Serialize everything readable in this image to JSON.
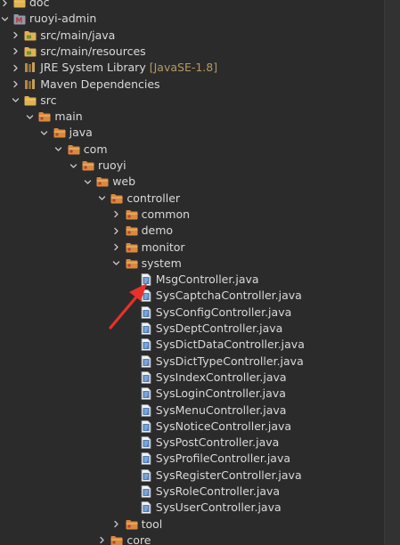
{
  "tree": {
    "items": [
      {
        "label": "doc",
        "decoration": "",
        "icon": "folder-icon",
        "depth": 0,
        "expanded": false
      },
      {
        "label": "ruoyi-admin",
        "decoration": "",
        "icon": "maven-project-icon",
        "depth": 0,
        "expanded": true
      },
      {
        "label": "src/main/java",
        "decoration": "",
        "icon": "source-folder-icon",
        "depth": 1,
        "expanded": false
      },
      {
        "label": "src/main/resources",
        "decoration": "",
        "icon": "source-folder-icon",
        "depth": 1,
        "expanded": false
      },
      {
        "label": "JRE System Library",
        "decoration": "[JavaSE-1.8]",
        "icon": "library-icon",
        "depth": 1,
        "expanded": false
      },
      {
        "label": "Maven Dependencies",
        "decoration": "",
        "icon": "library-icon",
        "depth": 1,
        "expanded": false
      },
      {
        "label": "src",
        "decoration": "",
        "icon": "folder-icon",
        "depth": 1,
        "expanded": true
      },
      {
        "label": "main",
        "decoration": "",
        "icon": "folder-icon",
        "depth": 2,
        "expanded": true
      },
      {
        "label": "java",
        "decoration": "",
        "icon": "folder-icon",
        "depth": 3,
        "expanded": true
      },
      {
        "label": "com",
        "decoration": "",
        "icon": "folder-icon",
        "depth": 4,
        "expanded": true
      },
      {
        "label": "ruoyi",
        "decoration": "",
        "icon": "folder-icon",
        "depth": 5,
        "expanded": true
      },
      {
        "label": "web",
        "decoration": "",
        "icon": "folder-icon",
        "depth": 6,
        "expanded": true
      },
      {
        "label": "controller",
        "decoration": "",
        "icon": "folder-icon",
        "depth": 7,
        "expanded": true
      },
      {
        "label": "common",
        "decoration": "",
        "icon": "folder-icon",
        "depth": 8,
        "expanded": false
      },
      {
        "label": "demo",
        "decoration": "",
        "icon": "folder-icon",
        "depth": 8,
        "expanded": false
      },
      {
        "label": "monitor",
        "decoration": "",
        "icon": "folder-icon",
        "depth": 8,
        "expanded": false
      },
      {
        "label": "system",
        "decoration": "",
        "icon": "folder-icon",
        "depth": 8,
        "expanded": true
      },
      {
        "label": "MsgController.java",
        "decoration": "",
        "icon": "java-file-icon",
        "depth": 9,
        "expanded": null
      },
      {
        "label": "SysCaptchaController.java",
        "decoration": "",
        "icon": "java-file-icon",
        "depth": 9,
        "expanded": null
      },
      {
        "label": "SysConfigController.java",
        "decoration": "",
        "icon": "java-file-icon",
        "depth": 9,
        "expanded": null
      },
      {
        "label": "SysDeptController.java",
        "decoration": "",
        "icon": "java-file-icon",
        "depth": 9,
        "expanded": null
      },
      {
        "label": "SysDictDataController.java",
        "decoration": "",
        "icon": "java-file-icon",
        "depth": 9,
        "expanded": null
      },
      {
        "label": "SysDictTypeController.java",
        "decoration": "",
        "icon": "java-file-icon",
        "depth": 9,
        "expanded": null
      },
      {
        "label": "SysIndexController.java",
        "decoration": "",
        "icon": "java-file-icon",
        "depth": 9,
        "expanded": null
      },
      {
        "label": "SysLoginController.java",
        "decoration": "",
        "icon": "java-file-icon",
        "depth": 9,
        "expanded": null
      },
      {
        "label": "SysMenuController.java",
        "decoration": "",
        "icon": "java-file-icon",
        "depth": 9,
        "expanded": null
      },
      {
        "label": "SysNoticeController.java",
        "decoration": "",
        "icon": "java-file-icon",
        "depth": 9,
        "expanded": null
      },
      {
        "label": "SysPostController.java",
        "decoration": "",
        "icon": "java-file-icon",
        "depth": 9,
        "expanded": null
      },
      {
        "label": "SysProfileController.java",
        "decoration": "",
        "icon": "java-file-icon",
        "depth": 9,
        "expanded": null
      },
      {
        "label": "SysRegisterController.java",
        "decoration": "",
        "icon": "java-file-icon",
        "depth": 9,
        "expanded": null
      },
      {
        "label": "SysRoleController.java",
        "decoration": "",
        "icon": "java-file-icon",
        "depth": 9,
        "expanded": null
      },
      {
        "label": "SysUserController.java",
        "decoration": "",
        "icon": "java-file-icon",
        "depth": 9,
        "expanded": null
      },
      {
        "label": "tool",
        "decoration": "",
        "icon": "folder-icon",
        "depth": 8,
        "expanded": false
      },
      {
        "label": "core",
        "decoration": "",
        "icon": "folder-icon",
        "depth": 7,
        "expanded": false
      }
    ],
    "highlighted_item": "MsgController.java"
  },
  "colors": {
    "background": "#2b2b2b",
    "text": "#d9d9d9",
    "decoration": "#b59a5d",
    "annotation_arrow": "#e8312a",
    "folder": "#e0b252",
    "package_folder": "#d98a3d",
    "java_file": "#4a7fc0"
  }
}
